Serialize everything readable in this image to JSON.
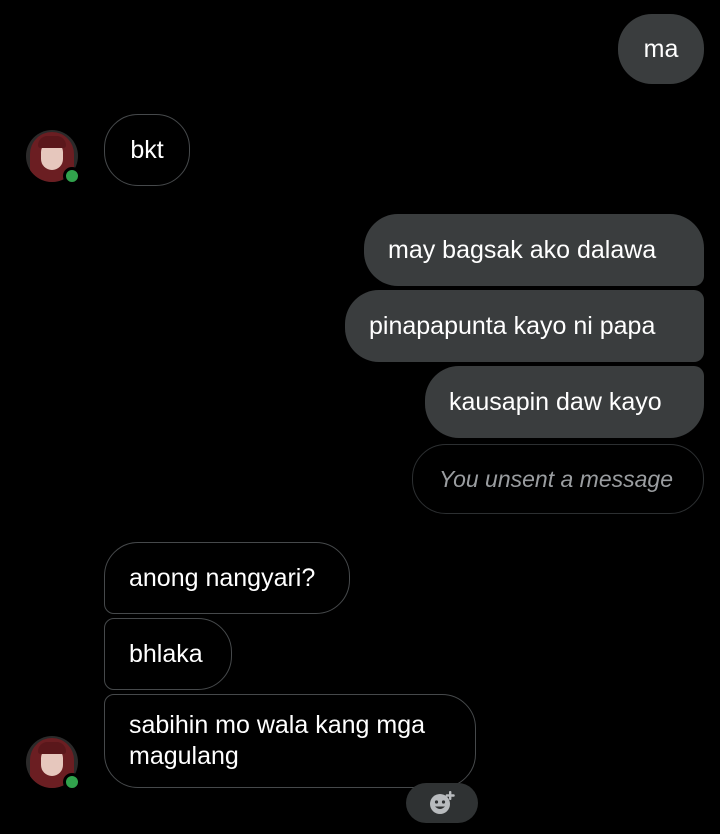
{
  "messages": {
    "m1": "ma",
    "m2": "bkt",
    "m3": "may bagsak ako dalawa",
    "m4": "pinapapunta kayo ni papa",
    "m5": "kausapin daw kayo",
    "m6": "You unsent a message",
    "m7": "anong nangyari?",
    "m8": "bhlaka",
    "m9": "sabihin mo wala kang mga magulang"
  },
  "icons": {
    "reaction": "add-reaction-icon",
    "presence": "online-status-dot"
  },
  "colors": {
    "background": "#000000",
    "outgoing_bubble": "#3a3d3e",
    "incoming_border": "#46494b",
    "online": "#31a24c",
    "unsent_text": "#9a9da0"
  }
}
